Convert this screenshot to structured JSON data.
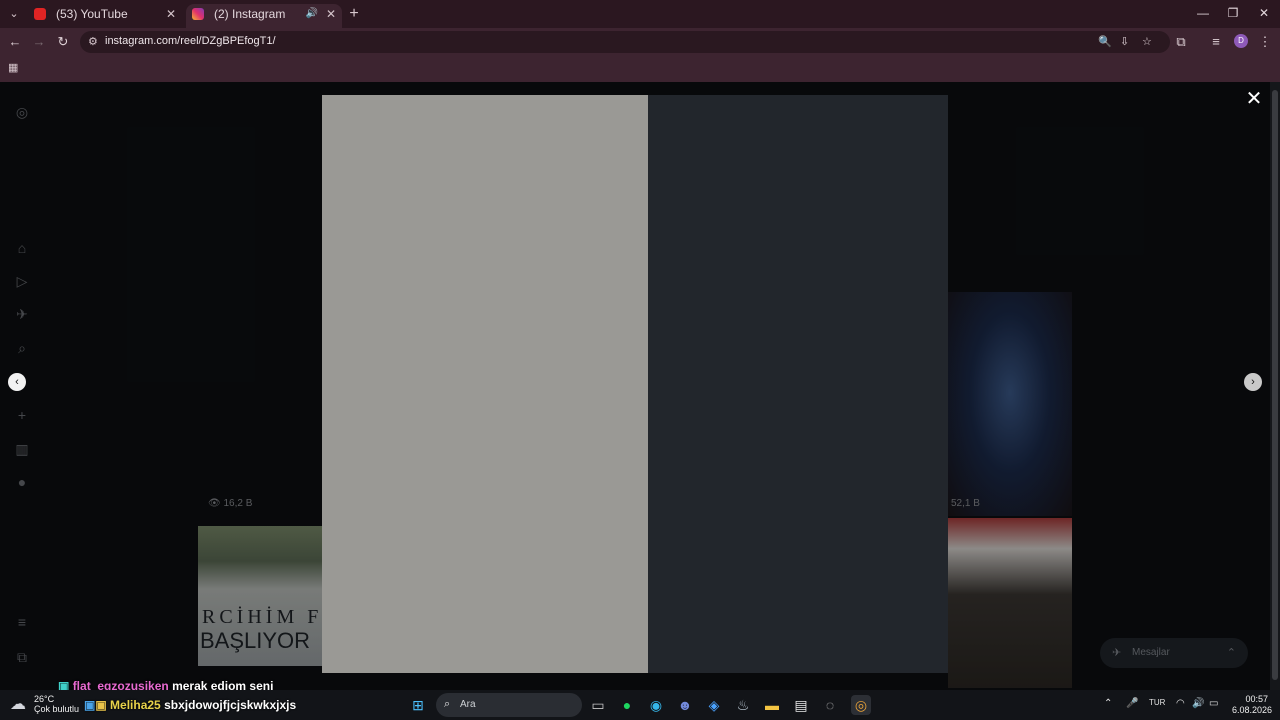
{
  "browser": {
    "tabs": [
      {
        "title": "(53) YouTube",
        "active": false
      },
      {
        "title": "(2) Instagram",
        "active": true
      }
    ],
    "url": "instagram.com/reel/DZgBPEfogT1/",
    "profile_initial": "D"
  },
  "instagram": {
    "left_thumb": {
      "views": "16,2 B",
      "line1": "RCİHİM F",
      "line2": "BAŞLIYOR"
    },
    "right_thumb": {
      "views": "52,1 B"
    },
    "messages_label": "Mesajlar"
  },
  "stream_chat": [
    {
      "user": "flat_egzozusiken",
      "message": "merak ediom seni"
    },
    {
      "user": "Meliha25",
      "message": "sbxjdowojfjcjskwkxjxjs"
    }
  ],
  "taskbar": {
    "weather_temp": "26°C",
    "weather_desc": "Çok bulutlu",
    "search_label": "Ara",
    "language": "TUR",
    "time": "00:57",
    "date": "6.08.2026"
  }
}
